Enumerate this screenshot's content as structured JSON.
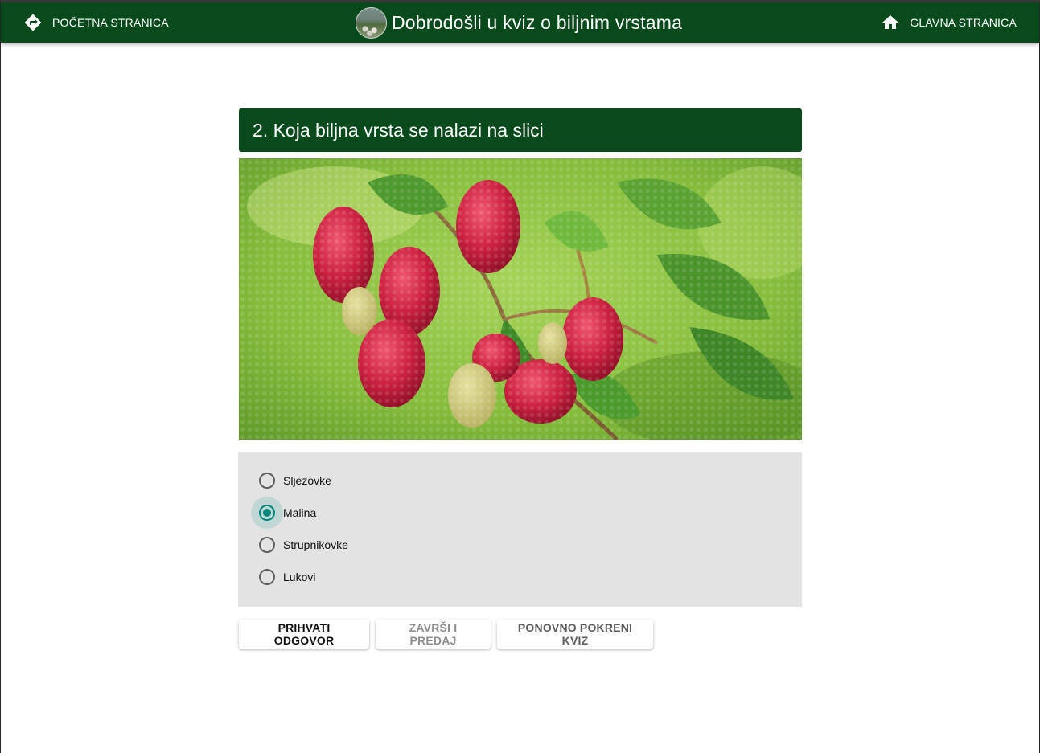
{
  "header": {
    "left_nav_label": "POČETNA STRANICA",
    "left_nav_icon": "directions-icon",
    "title": "Dobrodošli u kviz o biljnim vrstama",
    "right_nav_label": "GLAVNA STRANICA",
    "right_nav_icon": "home-icon",
    "background_color": "#084a1b"
  },
  "question": {
    "title": "2. Koja biljna vrsta se nalazi na slici"
  },
  "image": {
    "subject": "raspberry plant with ripe red berries"
  },
  "options": [
    {
      "label": "Sljezovke",
      "selected": false
    },
    {
      "label": "Malina",
      "selected": true
    },
    {
      "label": "Strupnikovke",
      "selected": false
    },
    {
      "label": "Lukovi",
      "selected": false
    }
  ],
  "buttons": {
    "accept": "PRIHVATI ODGOVOR",
    "finish": "ZAVRŠI I PREDAJ",
    "restart": "PONOVNO POKRENI KVIZ"
  },
  "colors": {
    "accent": "#00897b",
    "panel": "#e3e3e3"
  }
}
